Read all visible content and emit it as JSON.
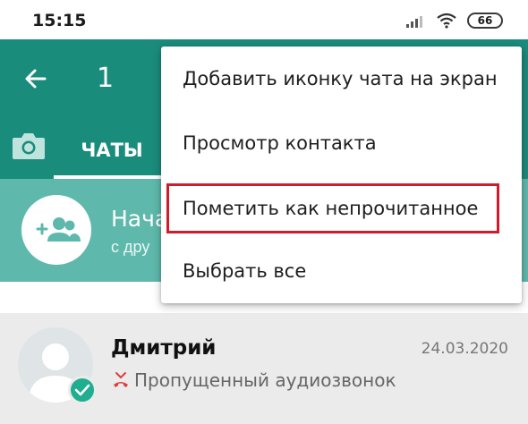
{
  "status_bar": {
    "time": "15:15",
    "battery": "66",
    "icons": [
      "signal-icon",
      "wifi-icon",
      "battery-icon"
    ]
  },
  "app_bar": {
    "selected_count": "1",
    "tab_chats": "ЧАТЫ",
    "color": "#1a8c7c",
    "icons": [
      "back-arrow-icon",
      "camera-icon"
    ]
  },
  "banner": {
    "title": "Нача",
    "subtitle": "с дру",
    "icon": "add-group-icon"
  },
  "chat": {
    "name": "Дмитрий",
    "date": "24.03.2020",
    "preview": "Пропущенный аудиозвонок",
    "icons": [
      "avatar-icon",
      "check-badge-icon",
      "missed-call-icon"
    ]
  },
  "menu": {
    "items": [
      {
        "label": "Добавить иконку чата на экран"
      },
      {
        "label": "Просмотр контакта"
      },
      {
        "label": "Пометить как непрочитанное"
      },
      {
        "label": "Выбрать все"
      }
    ],
    "highlight_color": "#d11a2a"
  }
}
